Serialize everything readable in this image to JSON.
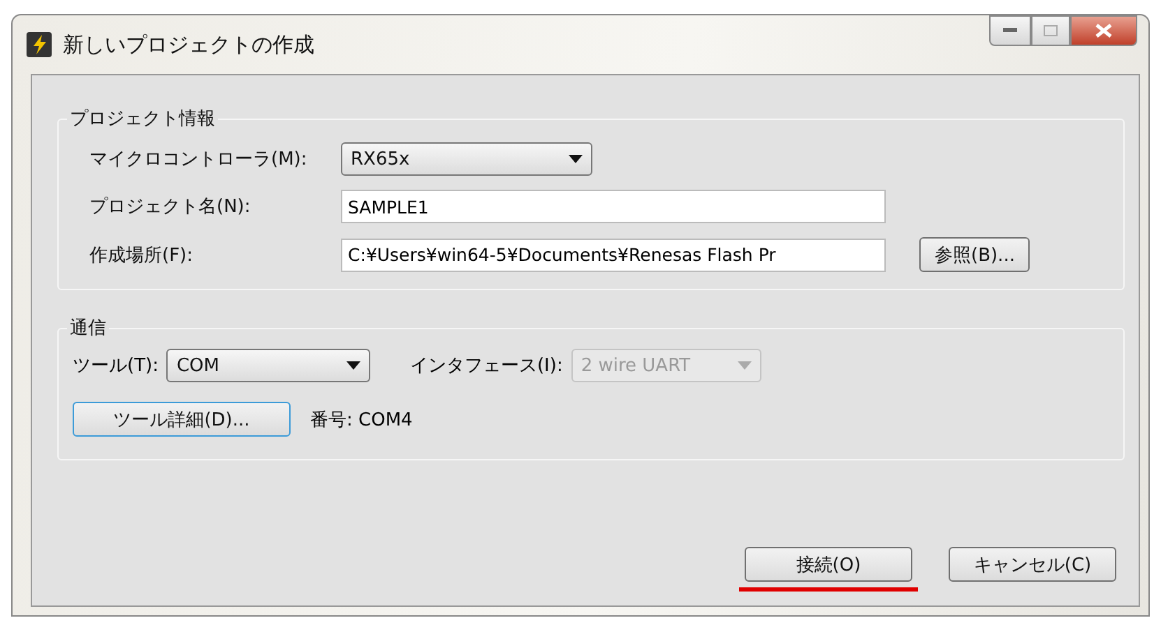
{
  "window": {
    "title": "新しいプロジェクトの作成"
  },
  "project_group": {
    "title": "プロジェクト情報",
    "fields": [
      {
        "kind": "select",
        "label": "マイクロコントローラ(M):",
        "value": "RX65x",
        "disabled": false
      },
      {
        "kind": "input",
        "label": "プロジェクト名(N):",
        "value": "SAMPLE1"
      },
      {
        "kind": "input",
        "label": "作成場所(F):",
        "value": "C:¥Users¥win64-5¥Documents¥Renesas Flash Pr",
        "button": "参照(B)..."
      }
    ]
  },
  "comm_group": {
    "title": "通信",
    "tool": {
      "label": "ツール(T):",
      "value": "COM",
      "disabled": false
    },
    "interface": {
      "label": "インタフェース(I):",
      "value": "2 wire UART",
      "disabled": true
    },
    "details_button": "ツール詳細(D)...",
    "number": "番号: COM4"
  },
  "buttons": [
    {
      "label": "接続(O)",
      "highlighted": true
    },
    {
      "label": "キャンセル(C)",
      "highlighted": false
    }
  ]
}
